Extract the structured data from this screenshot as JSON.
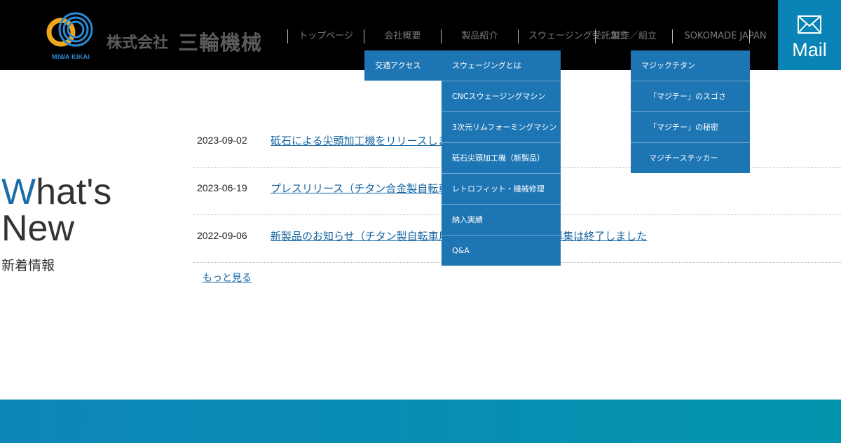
{
  "logo": {
    "subtext": "MIWA KIKAI"
  },
  "company": {
    "prefix": "株式会社",
    "name": "三輪機械"
  },
  "nav": [
    {
      "label": "トップページ"
    },
    {
      "label": "会社概要"
    },
    {
      "label": "製品紹介"
    },
    {
      "label": "スウェージング受託加工"
    },
    {
      "label": "製作／組立"
    },
    {
      "label": "SOKOMADE JAPAN"
    }
  ],
  "mail": {
    "label": "Mail"
  },
  "dropdowns": {
    "company": [
      "交通アクセス"
    ],
    "products": [
      "スウェージングとは",
      "CNCスウェージングマシン",
      "3次元リムフォーミングマシン",
      "砥石尖頭加工機（新製品）",
      "レトロフィット・機械修理",
      "納入実績",
      "Q&A"
    ],
    "sokomade": [
      "マジックチタン",
      "「マジチー」のスゴさ",
      "「マジチー」の秘密",
      "マジチーステッカー"
    ]
  },
  "whats_new": {
    "first_letter": "W",
    "heading_rest": "hat's",
    "heading_line2": "New",
    "subheading": "新着情報"
  },
  "news": [
    {
      "date": "2023-09-02",
      "title": "砥石による尖頭加工機をリリースしました"
    },
    {
      "date": "2023-06-19",
      "title": "プレスリリース（チタン合金製自転車用スポーク）"
    },
    {
      "date": "2022-09-06",
      "title": "新製品のお知らせ（チタン製自転車用スポーク）※モニター募集は終了しました"
    }
  ],
  "more_link": "もっと見る",
  "colors": {
    "header_bg": "#000000",
    "accent_blue": "#1d75b3",
    "mail_bg": "#0a84b6",
    "logo_orange": "#f0a81e",
    "logo_blue": "#2a8bd6",
    "link": "#1565a3"
  }
}
